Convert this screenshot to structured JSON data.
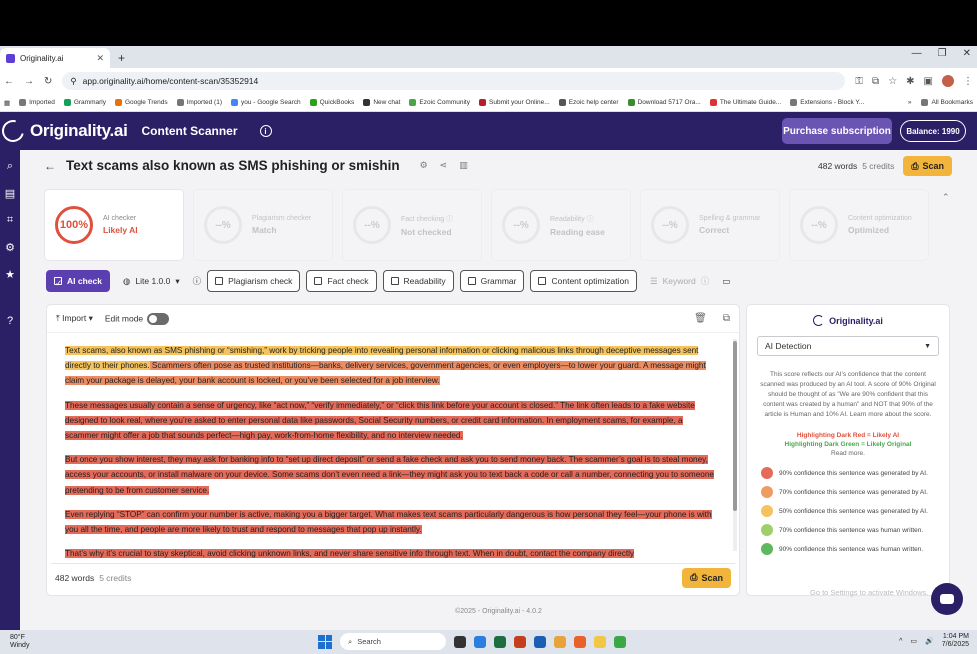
{
  "browser": {
    "tab_title": "Originality.ai",
    "url": "app.originality.ai/home/content-scan/35352914",
    "new_tab": "+",
    "bookmarks": [
      "Imported",
      "Grammarly",
      "Google Trends",
      "Imported (1)",
      "you - Google Search",
      "QuickBooks",
      "New chat",
      "Ezoic Community",
      "Submit your Online...",
      "Ezoic help center",
      "Download 5717 Ora...",
      "The Ultimate Guide...",
      "Extensions - Block Y..."
    ],
    "all_bookmarks": "All Bookmarks"
  },
  "header": {
    "brand": "Originality.ai",
    "section": "Content Scanner",
    "purchase": "Purchase subscription",
    "balance": "Balance: 1990"
  },
  "document": {
    "title": "Text scams also known as SMS phishing or smishin",
    "words": "482 words",
    "credits": "5 credits",
    "scan": "Scan"
  },
  "cards": [
    {
      "ring": "100%",
      "label": "AI checker",
      "value": "Likely AI"
    },
    {
      "ring": "--%",
      "label": "Plagiarism checker",
      "value": "Match"
    },
    {
      "ring": "--%",
      "label": "Fact checking ⓘ",
      "value": "Not checked"
    },
    {
      "ring": "--%",
      "label": "Readability ⓘ",
      "value": "Reading ease"
    },
    {
      "ring": "--%",
      "label": "Spelling & grammar",
      "value": "Correct"
    },
    {
      "ring": "--%",
      "label": "Content optimization",
      "value": "Optimized"
    }
  ],
  "toolbar": {
    "ai_check": "AI check",
    "model": "Lite 1.0.0",
    "plagiarism": "Plagiarism check",
    "fact": "Fact check",
    "readability": "Readability",
    "grammar": "Grammar",
    "content_opt": "Content optimization",
    "keyword": "Keyword"
  },
  "editor": {
    "import": "Import",
    "edit_mode": "Edit mode",
    "p1a": "Text scams, also known as SMS phishing or “smishing,” work by tricking people into revealing personal information or clicking malicious links through deceptive messages sent directly to their phones.",
    "p1b": " Scammers often pose as trusted institutions—banks, delivery services, government agencies, or even employers—to lower your guard.  A message might claim your package is delayed, your bank account is locked, or you’ve been selected for a job interview.",
    "p2": "These messages usually contain a sense of urgency, like “act now,” “verify immediately,” or “click this link before your account is closed.”  The link often leads to a fake website designed to look real, where you’re asked to enter personal data like passwords, Social Security numbers, or credit card information.  In employment scams, for example, a scammer might offer a job that sounds perfect—high pay, work-from-home flexibility, and no interview needed.",
    "p3": "But once you show interest, they may ask for banking info to “set up direct deposit” or send a fake check and ask you to send money back.  The scammer’s goal is to steal money, access your accounts, or install malware on your device.  Some scams don’t even need a link—they might ask you to text back a code or call a number, connecting you to someone pretending to be from customer service.",
    "p4": "Even replying “STOP” can confirm your number is active, making you a bigger target.  What makes text scams particularly dangerous is how personal they feel—your phone is with you all the time, and people are more likely to trust and respond to messages that pop up instantly.",
    "p5": "That’s why it’s crucial to stay skeptical, avoid clicking unknown links, and never share sensitive info through text.  When in doubt, contact the company directly"
  },
  "panel": {
    "brand": "Originality.ai",
    "select": "AI Detection",
    "explain": "This score reflects our AI's confidence that the content scanned was produced by an AI tool. A score of 90% Original should be thought of as \"We are 90% confident that this content was created by a human\" and NOT that 90% of the article is Human and 10% AI. Learn more about the score.",
    "legend_red": "Highlighting Dark Red = Likely AI",
    "legend_green": "Highlighting Dark Green = Likely Original",
    "read_more": "Read more.",
    "confidence": [
      {
        "text": "90% confidence this sentence was generated by AI.",
        "color": "#e46a5a"
      },
      {
        "text": "70% confidence this sentence was generated by AI.",
        "color": "#ed9c62"
      },
      {
        "text": "50% confidence this sentence was generated by AI.",
        "color": "#f4c35e"
      },
      {
        "text": "70% confidence this sentence was human written.",
        "color": "#9fcf6a"
      },
      {
        "text": "90% confidence this sentence was human written.",
        "color": "#5fb85f"
      }
    ],
    "watermark": "Go to Settings to activate Windows."
  },
  "footer": "©2025 - Originality.ai - 4.0.2",
  "taskbar": {
    "temp": "80°F",
    "condition": "Windy",
    "search": "Search",
    "time": "1:04 PM",
    "date": "7/6/2025"
  }
}
